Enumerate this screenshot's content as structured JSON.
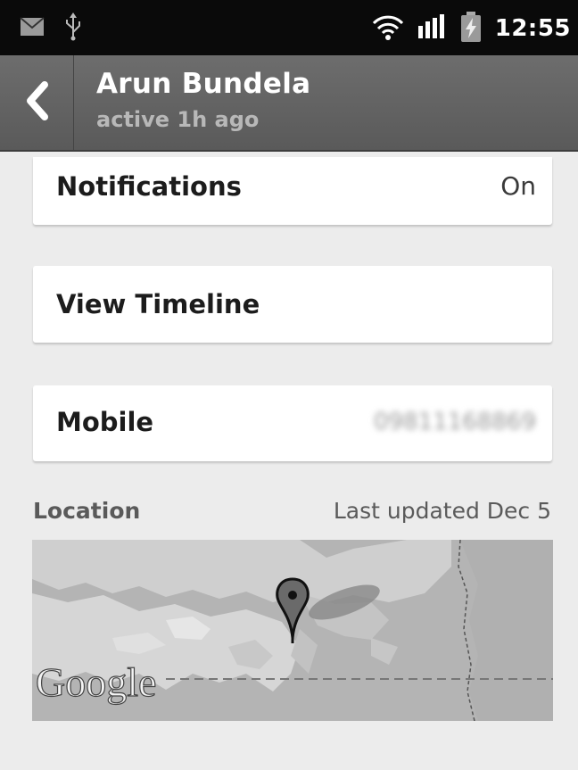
{
  "status_bar": {
    "time": "12:55",
    "icons": [
      "email-icon",
      "usb-icon",
      "wifi-icon",
      "signal-icon",
      "battery-charging-icon"
    ]
  },
  "action_bar": {
    "back_icon": "chevron-left-icon",
    "title": "Arun Bundela",
    "subtitle": "active 1h ago"
  },
  "settings": {
    "notifications": {
      "label": "Notifications",
      "value": "On"
    },
    "timeline": {
      "label": "View Timeline"
    },
    "mobile": {
      "label": "Mobile",
      "value": "09811168869"
    }
  },
  "location": {
    "label": "Location",
    "updated": "Last updated Dec 5",
    "map_logo": "Google",
    "marker_icon": "map-pin-icon"
  },
  "colors": {
    "status_bar": "#0a0a0a",
    "action_bar": "#636363",
    "background": "#ececec",
    "card": "#ffffff"
  }
}
